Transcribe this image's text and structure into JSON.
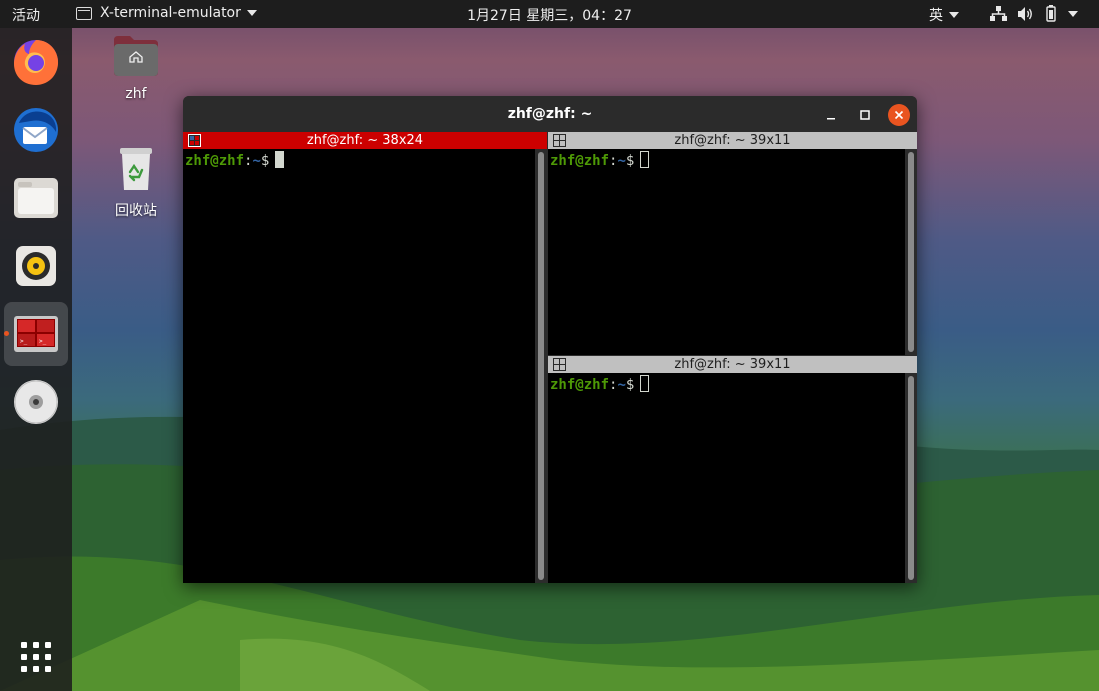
{
  "topbar": {
    "activities": "活动",
    "app_name": "X-terminal-emulator",
    "clock": "1月27日 星期三，04：27",
    "input_method": "英"
  },
  "dock": {
    "items": [
      {
        "name": "firefox-icon"
      },
      {
        "name": "thunderbird-icon"
      },
      {
        "name": "files-icon"
      },
      {
        "name": "rhythmbox-icon"
      },
      {
        "name": "terminator-icon",
        "active": true
      },
      {
        "name": "dvd-icon"
      }
    ]
  },
  "desktop": {
    "home_label": "zhf",
    "trash_label": "回收站"
  },
  "window": {
    "title": "zhf@zhf: ~",
    "panes": [
      {
        "header": "zhf@zhf: ~ 38x24",
        "focused": true,
        "user": "zhf@zhf",
        "sep": ":",
        "path": "~",
        "sym": "$"
      },
      {
        "header": "zhf@zhf: ~ 39x11",
        "focused": false,
        "user": "zhf@zhf",
        "sep": ":",
        "path": "~",
        "sym": "$"
      },
      {
        "header": "zhf@zhf: ~ 39x11",
        "focused": false,
        "user": "zhf@zhf",
        "sep": ":",
        "path": "~",
        "sym": "$"
      }
    ]
  },
  "colors": {
    "accent": "#e95420",
    "focused_header": "#cc0000",
    "unfocused_header": "#c0c0c0",
    "prompt_user": "#4e9a06",
    "prompt_path": "#3465a4"
  }
}
